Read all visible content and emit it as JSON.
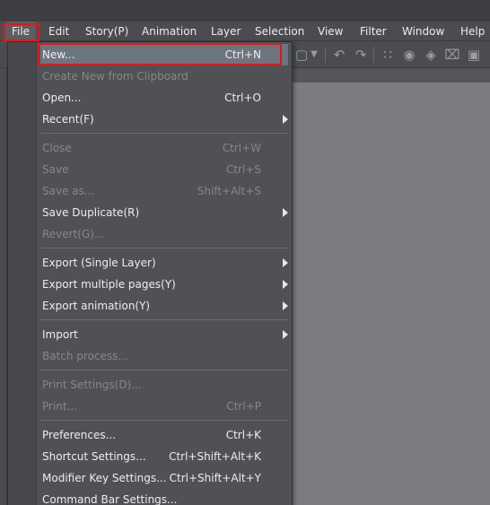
{
  "menubar": {
    "items": [
      "File",
      "Edit",
      "Story(P)",
      "Animation",
      "Layer",
      "Selection",
      "View",
      "Filter",
      "Window",
      "Help"
    ]
  },
  "file_menu": {
    "groups": [
      [
        {
          "label": "New...",
          "shortcut": "Ctrl+N",
          "disabled": false,
          "submenu": false,
          "highlighted": true
        },
        {
          "label": "Create New from Clipboard",
          "shortcut": "",
          "disabled": true,
          "submenu": false
        },
        {
          "label": "Open...",
          "shortcut": "Ctrl+O",
          "disabled": false,
          "submenu": false
        },
        {
          "label": "Recent(F)",
          "shortcut": "",
          "disabled": false,
          "submenu": true
        }
      ],
      [
        {
          "label": "Close",
          "shortcut": "Ctrl+W",
          "disabled": true,
          "submenu": false
        },
        {
          "label": "Save",
          "shortcut": "Ctrl+S",
          "disabled": true,
          "submenu": false
        },
        {
          "label": "Save as...",
          "shortcut": "Shift+Alt+S",
          "disabled": true,
          "submenu": false
        },
        {
          "label": "Save Duplicate(R)",
          "shortcut": "",
          "disabled": false,
          "submenu": true
        },
        {
          "label": "Revert(G)...",
          "shortcut": "",
          "disabled": true,
          "submenu": false
        }
      ],
      [
        {
          "label": "Export (Single Layer)",
          "shortcut": "",
          "disabled": false,
          "submenu": true
        },
        {
          "label": "Export multiple pages(Y)",
          "shortcut": "",
          "disabled": false,
          "submenu": true
        },
        {
          "label": "Export animation(Y)",
          "shortcut": "",
          "disabled": false,
          "submenu": true
        }
      ],
      [
        {
          "label": "Import",
          "shortcut": "",
          "disabled": false,
          "submenu": true
        },
        {
          "label": "Batch process...",
          "shortcut": "",
          "disabled": true,
          "submenu": false
        }
      ],
      [
        {
          "label": "Print Settings(D)...",
          "shortcut": "",
          "disabled": true,
          "submenu": false
        },
        {
          "label": "Print...",
          "shortcut": "Ctrl+P",
          "disabled": true,
          "submenu": false
        }
      ],
      [
        {
          "label": "Preferences...",
          "shortcut": "Ctrl+K",
          "disabled": false,
          "submenu": false
        },
        {
          "label": "Shortcut Settings...",
          "shortcut": "Ctrl+Shift+Alt+K",
          "disabled": false,
          "submenu": false
        },
        {
          "label": "Modifier Key Settings...",
          "shortcut": "Ctrl+Shift+Alt+Y",
          "disabled": false,
          "submenu": false
        },
        {
          "label": "Command Bar Settings...",
          "shortcut": "",
          "disabled": false,
          "submenu": false
        }
      ]
    ]
  },
  "toolbar": {
    "icons": [
      "square-icon",
      "dropdown-arrow-icon",
      "undo-icon",
      "redo-icon",
      "selection-dots-icon",
      "transform-icon",
      "fill-icon",
      "crop-icon",
      "fit-icon"
    ]
  },
  "colors": {
    "highlight": "#6c7580",
    "annotation_red": "#e01818",
    "disabled_text": "#85868b"
  }
}
